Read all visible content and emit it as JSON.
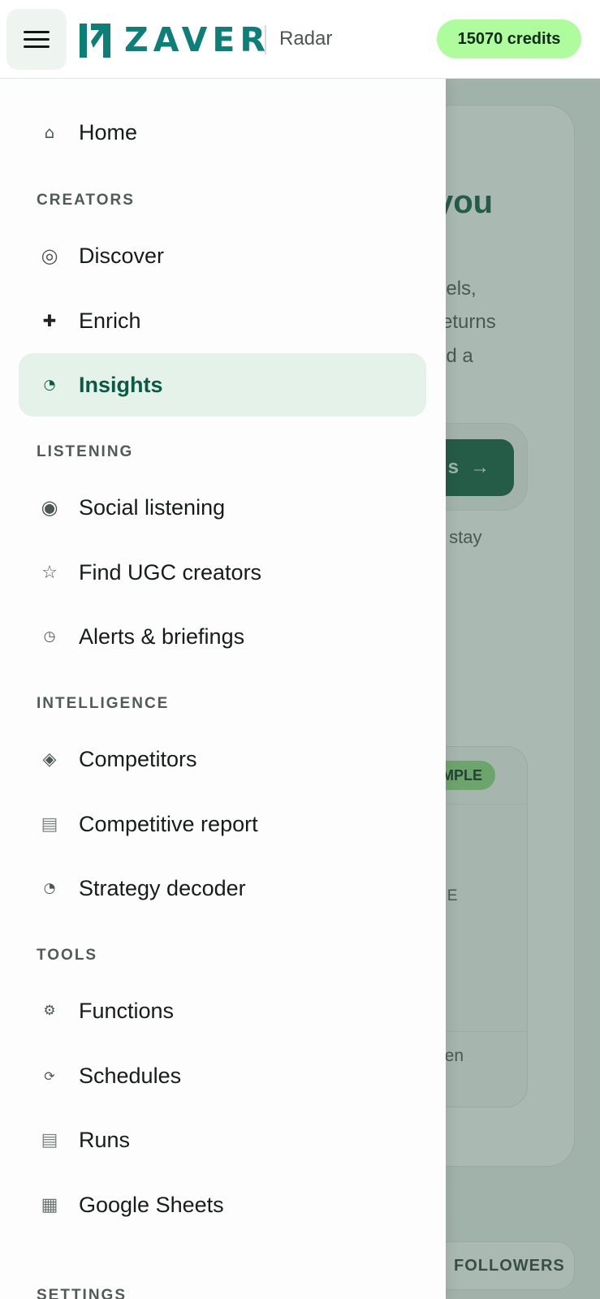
{
  "header": {
    "brand": "ZAVER",
    "product": "Radar",
    "credits": "15070 credits"
  },
  "background": {
    "title_fragment": "you",
    "body_lines": [
      "eels,",
      "returns",
      "nd a"
    ],
    "button_fragment": "s",
    "note_fragment": "s stay",
    "sample_badge": "AMPLE",
    "label_fragment": "CE",
    "open_fragment": "pen",
    "followers_pill": "FOLLOWERS"
  },
  "nav": {
    "home": "Home",
    "sections": {
      "creators": "CREATORS",
      "listening": "LISTENING",
      "intelligence": "INTELLIGENCE",
      "tools": "TOOLS",
      "settings": "SETTINGS"
    },
    "items": {
      "discover": "Discover",
      "enrich": "Enrich",
      "insights": "Insights",
      "social_listening": "Social listening",
      "find_ugc": "Find UGC creators",
      "alerts": "Alerts & briefings",
      "competitors": "Competitors",
      "competitive_report": "Competitive report",
      "strategy_decoder": "Strategy decoder",
      "functions": "Functions",
      "schedules": "Schedules",
      "runs": "Runs",
      "google_sheets": "Google Sheets"
    },
    "active": "insights"
  },
  "icons": {
    "home": "⌂",
    "discover": "◎",
    "enrich": "✚",
    "insights": "◔",
    "social_listening": "◉",
    "find_ugc": "☆",
    "alerts": "◷",
    "competitors": "◈",
    "competitive_report": "▤",
    "strategy_decoder": "◔",
    "functions": "⚙",
    "schedules": "⟳",
    "runs": "▤",
    "google_sheets": "▦",
    "arrow": "→"
  },
  "colors": {
    "brand_teal": "#0c7f79",
    "credits_bg": "#aefc9c",
    "active_bg": "#e4f2ea",
    "active_text": "#0b5a45",
    "primary_button": "#0f5a3f"
  }
}
